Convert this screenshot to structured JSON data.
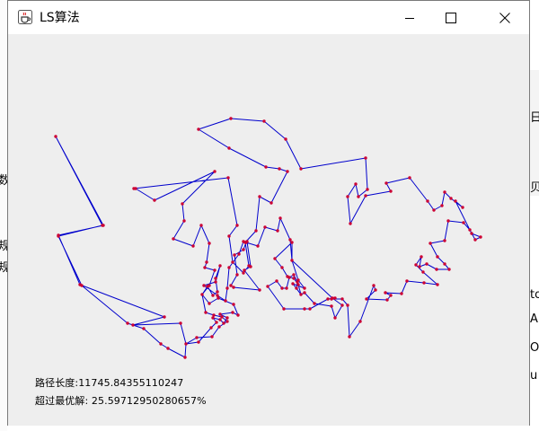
{
  "window": {
    "title": "LS算法",
    "icon": "java-coffee-icon"
  },
  "controls": {
    "minimize": "minimize-icon",
    "maximize": "maximize-icon",
    "close": "close-icon"
  },
  "status": {
    "path_length": "路径长度:11745.84355110247",
    "over_optimal": "超过最优解: 25.59712950280657%"
  },
  "colors": {
    "route": "#0000cc",
    "city": "#cc0033",
    "canvas": "#eeeeee"
  },
  "background_fragments": {
    "left": [
      "数",
      "规",
      "规"
    ],
    "right": [
      "日",
      "贝",
      "to",
      "A",
      "O",
      "u"
    ]
  }
}
